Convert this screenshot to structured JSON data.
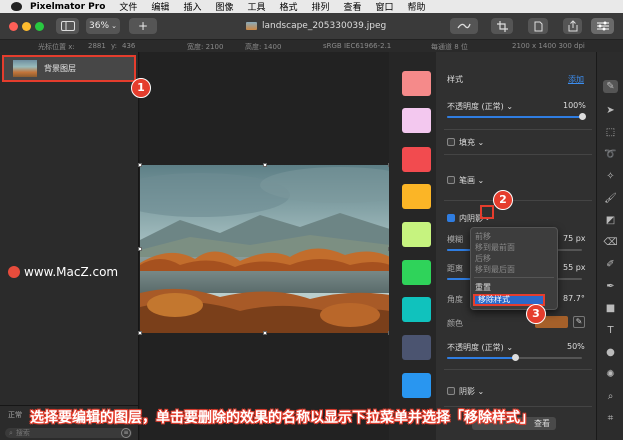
{
  "menubar": {
    "app_name": "Pixelmator Pro",
    "items": [
      "文件",
      "编辑",
      "插入",
      "图像",
      "工具",
      "格式",
      "排列",
      "查看",
      "窗口",
      "帮助"
    ]
  },
  "toolbar": {
    "zoom": "36%",
    "add_label": "+",
    "document_title": "landscape_205330039.jpeg"
  },
  "infobar": {
    "cursor_label": "光标位置 x:",
    "cursor_x": "2881",
    "cursor_y_label": "y:",
    "cursor_y": "436",
    "width": "宽度: 2100",
    "height": "高度: 1400",
    "colorspace": "sRGB IEC61966-2.1",
    "channel": "每通道 8 位",
    "size": "2100 x 1400 300 dpi"
  },
  "layers": {
    "items": [
      {
        "name": "背景图层"
      }
    ],
    "blend_mode": "正常",
    "search_placeholder": "搜索"
  },
  "watermark": "www.MacZ.com",
  "swatch_colors": [
    "#f58a8a",
    "#f3c8ef",
    "#f24b4f",
    "#fbb526",
    "#c6f37f",
    "#2fd35a",
    "#10c2bd",
    "#4b5470",
    "#2996f0"
  ],
  "props": {
    "style_title": "样式",
    "add_link": "添加",
    "opacity_label": "不透明度 (正常) ⌄",
    "opacity_value": "100%",
    "fill_label": "填充 ⌄",
    "stroke_label": "笔画 ⌄",
    "inner_shadow_label": "内阴影",
    "blur_label": "模糊",
    "blur_value": "75 px",
    "distance_label": "距离",
    "distance_value": "55 px",
    "angle_label": "角度",
    "angle_value": "87.7°",
    "color_label": "颜色",
    "opacity2_label": "不透明度 (正常) ⌄",
    "opacity2_value": "50%",
    "shadow_label": "阴影 ⌄",
    "apply_label": "查看",
    "opacity_level": 1.0,
    "blur_level": 0.7,
    "distance_level": 0.55,
    "opacity2_level": 0.5
  },
  "dropdown": {
    "items": [
      "前移",
      "移到最前面",
      "后移",
      "移到最后面"
    ],
    "reset": "重置",
    "remove": "移除样式"
  },
  "badges": [
    "1",
    "2",
    "3"
  ],
  "caption": "选择要编辑的图层，单击要删除的效果的名称以显示下拉菜单并选择「移除样式」"
}
